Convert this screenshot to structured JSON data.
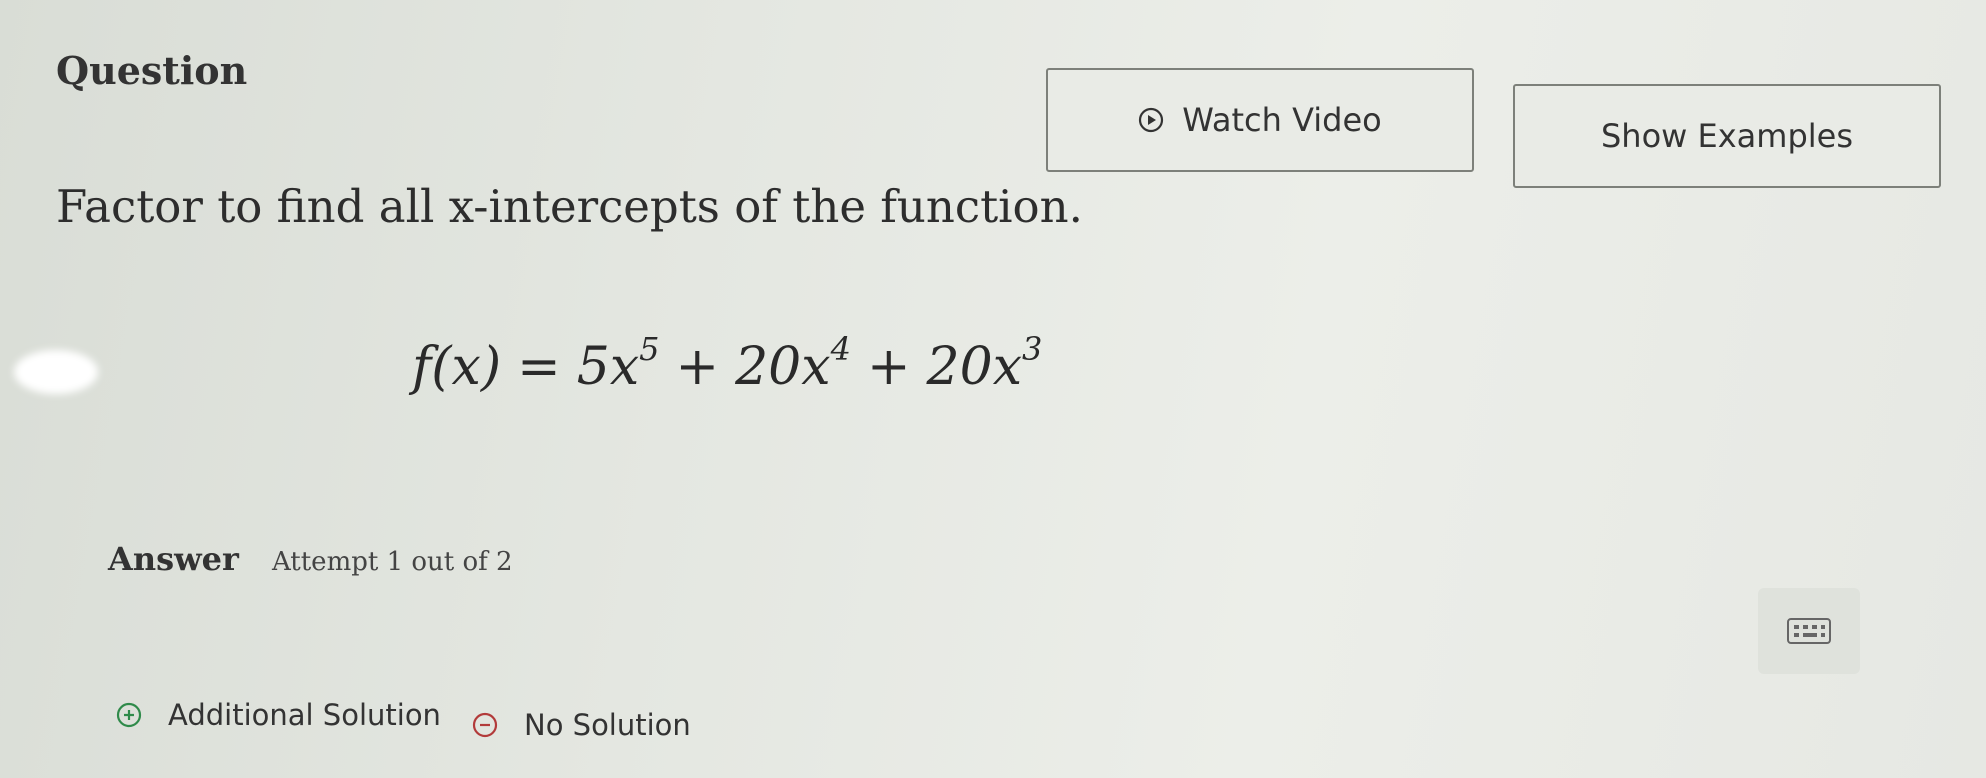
{
  "question": {
    "header": "Question",
    "prompt": "Factor to find all x-intercepts of the function.",
    "equation": {
      "lhs": "f(x)",
      "equals": "=",
      "term1_coef": "5x",
      "term1_exp": "5",
      "plus1": "+",
      "term2_coef": "20x",
      "term2_exp": "4",
      "plus2": "+",
      "term3_coef": "20x",
      "term3_exp": "3"
    }
  },
  "toolbar": {
    "watch_video_label": "Watch Video",
    "show_examples_label": "Show Examples"
  },
  "answer": {
    "label": "Answer",
    "attempt_text": "Attempt 1 out of 2"
  },
  "options": {
    "additional_solution": "Additional Solution",
    "no_solution": "No Solution"
  },
  "icons": {
    "watch_video": "play-circle-icon",
    "keypad": "keypad-icon",
    "add": "plus-circle-icon",
    "none": "minus-circle-icon"
  }
}
